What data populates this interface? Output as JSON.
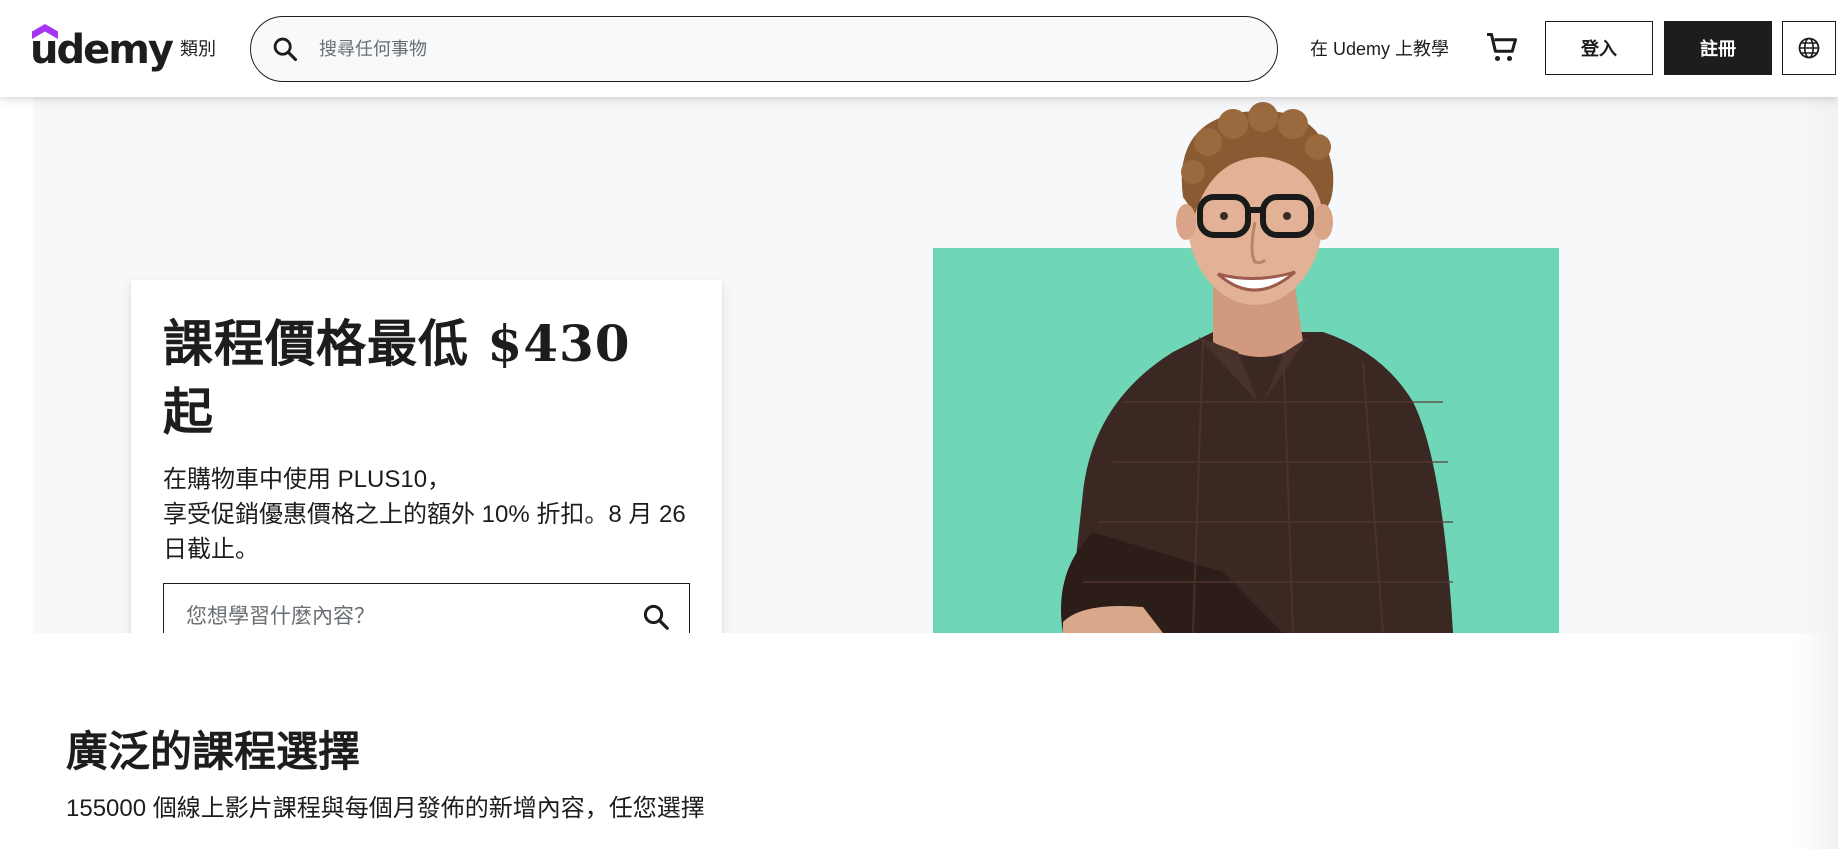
{
  "header": {
    "logo_text": "udemy",
    "categories_label": "類別",
    "search_placeholder": "搜尋任何事物",
    "teach_label": "在 Udemy 上教學",
    "login_label": "登入",
    "signup_label": "註冊",
    "icons": {
      "search": "search-icon",
      "cart": "cart-icon",
      "language": "globe-icon"
    }
  },
  "hero": {
    "title": "課程價格最低 $430 起",
    "text_line1": "在購物車中使用 PLUS10，",
    "text_line2": "享受促銷優惠價格之上的額外 10% 折扣。8 月 26 日截止。",
    "search_placeholder": "您想學習什麼內容？",
    "colors": {
      "accent": "#6fd6b8",
      "background": "#f7f8fa"
    }
  },
  "section": {
    "title": "廣泛的課程選擇",
    "subtitle": "155000 個線上影片課程與每個月發佈的新增內容，任您選擇"
  },
  "colors": {
    "primary": "#1c1d1f",
    "brand": "#a435f0",
    "muted": "#6a6f73"
  }
}
